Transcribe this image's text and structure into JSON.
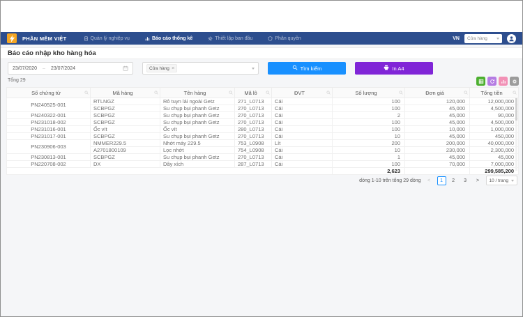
{
  "colors": {
    "navbar": "#2d4e8e",
    "primary_blue": "#1890ff",
    "print_purple": "#8025d7",
    "logo_orange": "#f5a623"
  },
  "navbar": {
    "brand": "PHẦN MỀM VIỆT",
    "menu": [
      {
        "label": "Quản lý nghiệp vụ",
        "icon": "clipboard",
        "active": false
      },
      {
        "label": "Báo cáo thống kê",
        "icon": "chart",
        "active": true
      },
      {
        "label": "Thiết lập ban đầu",
        "icon": "gear",
        "active": false
      },
      {
        "label": "Phân quyền",
        "icon": "shield",
        "active": false
      }
    ],
    "language": "VN",
    "store_select_value": "Cửa hàng"
  },
  "page": {
    "title": "Báo cáo nhập kho hàng hóa",
    "filters": {
      "date_from": "23/07/2020",
      "date_separator": "–",
      "date_to": "23/07/2024",
      "store_tag": "Cửa hàng",
      "tag_remove": "×",
      "search_button": "Tìm kiếm",
      "print_button": "In A4"
    },
    "total_label": "Tổng 29"
  },
  "toolbar_buttons": [
    {
      "name": "export-excel",
      "color": "#4caf2f"
    },
    {
      "name": "sync",
      "color": "#b57ce3"
    },
    {
      "name": "chart",
      "color": "#f291b6"
    },
    {
      "name": "settings",
      "color": "#9b9b9b"
    }
  ],
  "table": {
    "columns": [
      "Số chứng từ",
      "Mã hàng",
      "Tên hàng",
      "Mã lô",
      "ĐVT",
      "Số lượng",
      "Đơn giá",
      "Tổng tiền"
    ],
    "rows": [
      {
        "doc": "PN240525-001",
        "span": 2,
        "ma_hang": "RTLNGZ",
        "ten_hang": "Rô tuyn lái ngoài Getz",
        "ma_lo": "271_L0713",
        "dvt": "Cái",
        "so_luong": "100",
        "don_gia": "120,000",
        "tong_tien": "12,000,000"
      },
      {
        "doc": null,
        "ma_hang": "SCBPGZ",
        "ten_hang": "Su chụp bụi phanh Getz",
        "ma_lo": "270_L0713",
        "dvt": "Cái",
        "so_luong": "100",
        "don_gia": "45,000",
        "tong_tien": "4,500,000"
      },
      {
        "doc": "PN240322-001",
        "ma_hang": "SCBPGZ",
        "ten_hang": "Su chụp bụi phanh Getz",
        "ma_lo": "270_L0713",
        "dvt": "Cái",
        "so_luong": "2",
        "don_gia": "45,000",
        "tong_tien": "90,000"
      },
      {
        "doc": "PN231018-002",
        "ma_hang": "SCBPGZ",
        "ten_hang": "Su chụp bụi phanh Getz",
        "ma_lo": "270_L0713",
        "dvt": "Cái",
        "so_luong": "100",
        "don_gia": "45,000",
        "tong_tien": "4,500,000"
      },
      {
        "doc": "PN231016-001",
        "ma_hang": "Ốc vít",
        "ten_hang": "Ốc vít",
        "ma_lo": "280_L0713",
        "dvt": "Cái",
        "so_luong": "100",
        "don_gia": "10,000",
        "tong_tien": "1,000,000"
      },
      {
        "doc": "PN231017-001",
        "ma_hang": "SCBPGZ",
        "ten_hang": "Su chụp bụi phanh Getz",
        "ma_lo": "270_L0713",
        "dvt": "Cái",
        "so_luong": "10",
        "don_gia": "45,000",
        "tong_tien": "450,000"
      },
      {
        "doc": "PN230906-003",
        "span": 2,
        "ma_hang": "NMMER229.5",
        "ten_hang": "Nhớt máy 229.5",
        "ma_lo": "753_L0908",
        "dvt": "Lít",
        "so_luong": "200",
        "don_gia": "200,000",
        "tong_tien": "40,000,000"
      },
      {
        "doc": null,
        "ma_hang": "A2701800109",
        "ten_hang": "Lọc nhớt",
        "ma_lo": "754_L0908",
        "dvt": "Cái",
        "so_luong": "10",
        "don_gia": "230,000",
        "tong_tien": "2,300,000"
      },
      {
        "doc": "PN230813-001",
        "ma_hang": "SCBPGZ",
        "ten_hang": "Su chụp bụi phanh Getz",
        "ma_lo": "270_L0713",
        "dvt": "Cái",
        "so_luong": "1",
        "don_gia": "45,000",
        "tong_tien": "45,000"
      },
      {
        "doc": "PN220708-002",
        "ma_hang": "DX",
        "ten_hang": "Dây xích",
        "ma_lo": "287_L0713",
        "dvt": "Cái",
        "so_luong": "100",
        "don_gia": "70,000",
        "tong_tien": "7,000,000"
      }
    ],
    "summary": {
      "so_luong": "2,623",
      "tong_tien": "299,585,200"
    }
  },
  "pagination": {
    "info": "dòng 1-10 trên tổng 29 dòng",
    "prev": "<",
    "next": ">",
    "pages": [
      "1",
      "2",
      "3"
    ],
    "active_page": "1",
    "page_size": "10 / trang"
  }
}
